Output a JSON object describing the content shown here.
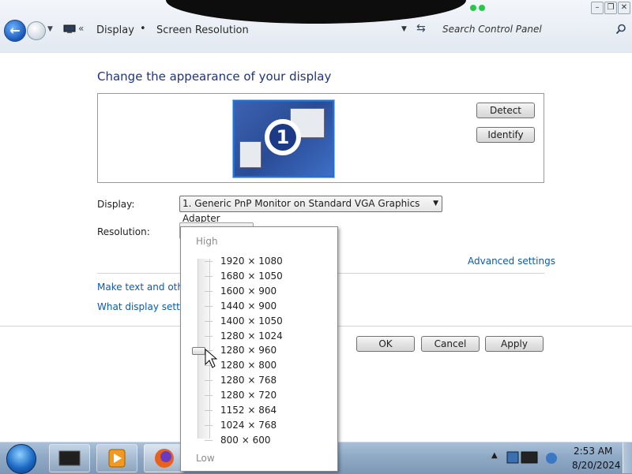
{
  "window": {
    "controls": [
      "minimize",
      "restore",
      "close"
    ]
  },
  "address_bar": {
    "breadcrumb": [
      "Display",
      "Screen Resolution"
    ],
    "separator": "•",
    "overflow": "«",
    "search_placeholder": "Search Control Panel"
  },
  "main": {
    "title": "Change the appearance of your display",
    "monitor_number": "1",
    "detect_label": "Detect",
    "identify_label": "Identify",
    "display_label": "Display:",
    "display_value": "1. Generic PnP Monitor on Standard VGA Graphics Adapter",
    "resolution_label": "Resolution:",
    "advanced_link": "Advanced settings",
    "link_text_size": "Make text and other",
    "link_what_settings": "What display setting",
    "ok_label": "OK",
    "cancel_label": "Cancel",
    "apply_label": "Apply"
  },
  "resolution_dropdown": {
    "high_label": "High",
    "low_label": "Low",
    "options": [
      "1920 × 1080",
      "1680 × 1050",
      "1600 × 900",
      "1440 × 900",
      "1400 × 1050",
      "1280 × 1024",
      "1280 × 960",
      "1280 × 800",
      "1280 × 768",
      "1280 × 720",
      "1152 × 864",
      "1024 × 768",
      "800 × 600"
    ],
    "selected": "1280 × 960"
  },
  "taskbar": {
    "time": "2:53 AM",
    "date": "8/20/2024",
    "pinned": [
      "media-center-icon",
      "media-player-icon",
      "firefox-icon"
    ]
  },
  "colors": {
    "title_blue": "#1e3287",
    "link_blue": "#0b5ab0",
    "monitor_blue": "#2a4c96"
  }
}
